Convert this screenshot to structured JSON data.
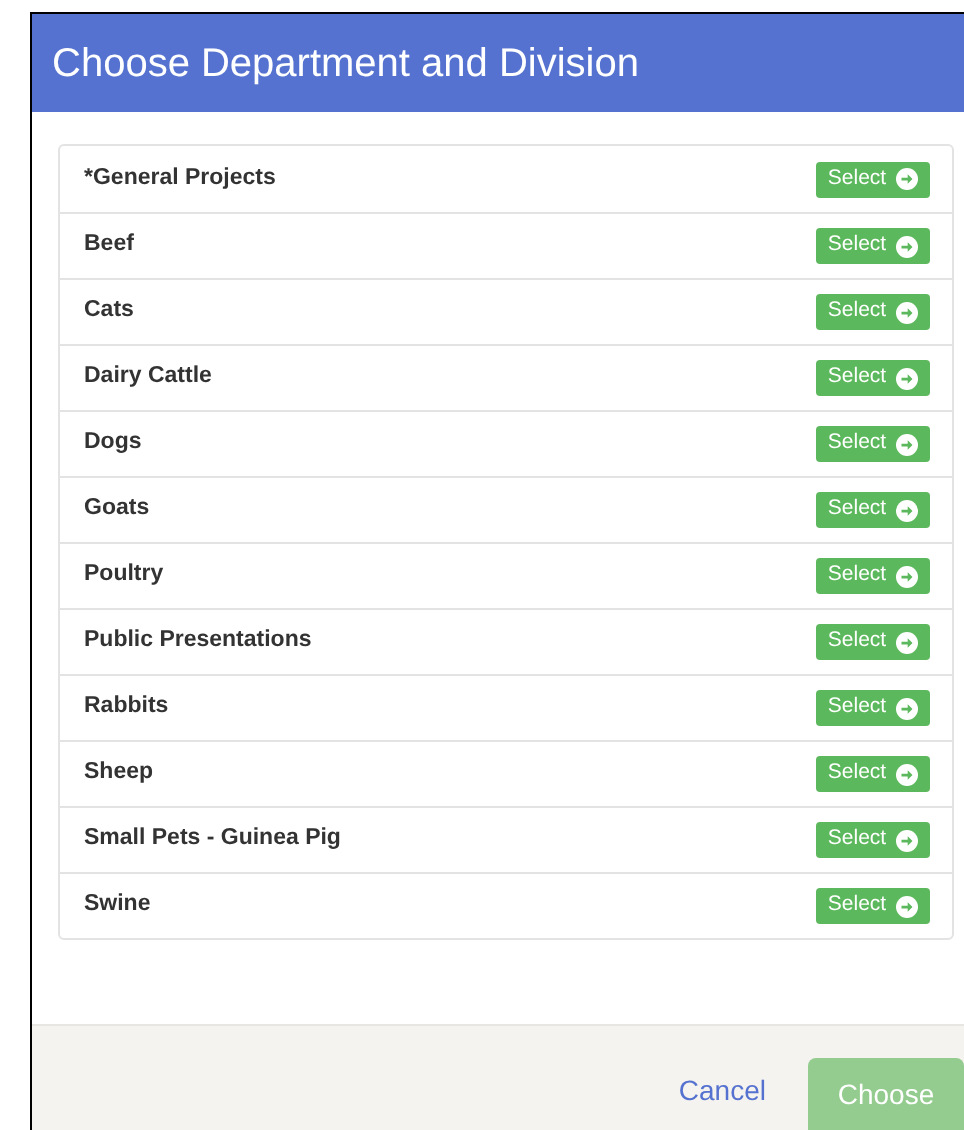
{
  "dialog": {
    "title": "Choose Department and Division"
  },
  "departments": [
    {
      "name": "*General Projects",
      "button": "Select"
    },
    {
      "name": "Beef",
      "button": "Select"
    },
    {
      "name": "Cats",
      "button": "Select"
    },
    {
      "name": "Dairy Cattle",
      "button": "Select"
    },
    {
      "name": "Dogs",
      "button": "Select"
    },
    {
      "name": "Goats",
      "button": "Select"
    },
    {
      "name": "Poultry",
      "button": "Select"
    },
    {
      "name": "Public Presentations",
      "button": "Select"
    },
    {
      "name": "Rabbits",
      "button": "Select"
    },
    {
      "name": "Sheep",
      "button": "Select"
    },
    {
      "name": "Small Pets - Guinea Pig",
      "button": "Select"
    },
    {
      "name": "Swine",
      "button": "Select"
    }
  ],
  "footer": {
    "cancel": "Cancel",
    "choose": {
      "label": "Choose",
      "disabled": true
    }
  }
}
